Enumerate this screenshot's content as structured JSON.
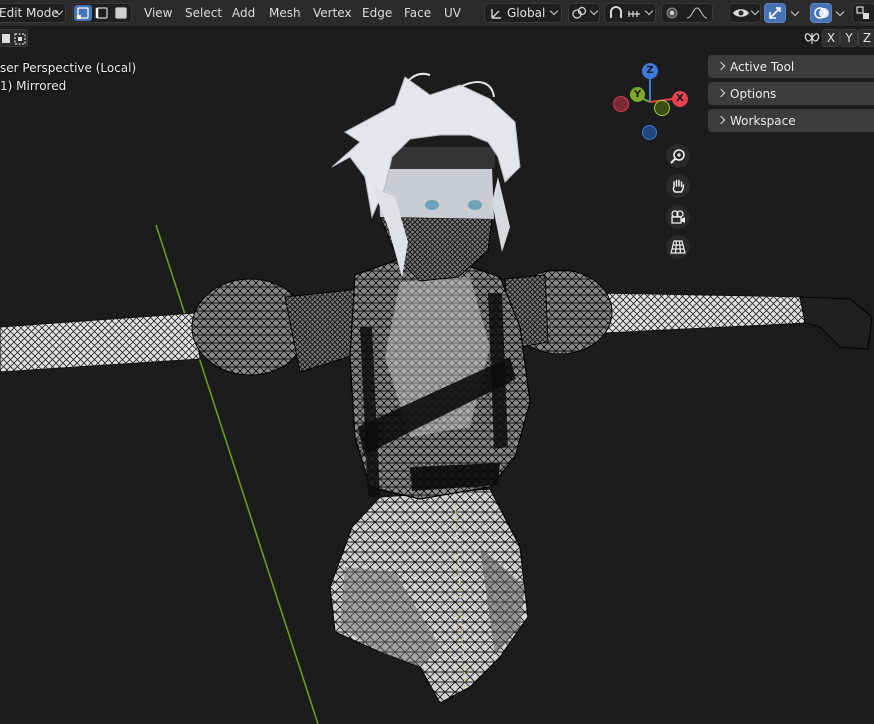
{
  "header": {
    "mode": "Edit Mode",
    "menus": [
      "View",
      "Select",
      "Add",
      "Mesh",
      "Vertex",
      "Edge",
      "Face",
      "UV"
    ],
    "orientation": "Global",
    "axes": [
      "X",
      "Y",
      "Z"
    ]
  },
  "viewport": {
    "perspective": "ser Perspective (Local)",
    "object": "1) Mirrored"
  },
  "panels": [
    "Active Tool",
    "Options",
    "Workspace"
  ],
  "gizmo": {
    "z": "Z",
    "y": "Y",
    "x": "X"
  },
  "colors": {
    "accent": "#4772b3",
    "header_bg": "#2b2b2b",
    "viewport_bg": "#1c1c1c",
    "axis_x": "#e0404f",
    "axis_y": "#7ea82c",
    "axis_z": "#3d7ae0",
    "y_axis_line": "#6d9a1f"
  },
  "icons": [
    "edit-mode-icon",
    "vertex-select-icon",
    "edge-select-icon",
    "face-select-icon",
    "transform-orientation-icon",
    "pivot-icon",
    "snap-icon",
    "increment-icon",
    "proportional-edit-icon",
    "falloff-icon",
    "visibility-icon",
    "gizmo-toggle-icon",
    "overlay-icon",
    "xray-icon",
    "zoom-icon",
    "hand-pan-icon",
    "camera-icon",
    "grid-perspective-icon",
    "mirror-butterfly-icon"
  ]
}
